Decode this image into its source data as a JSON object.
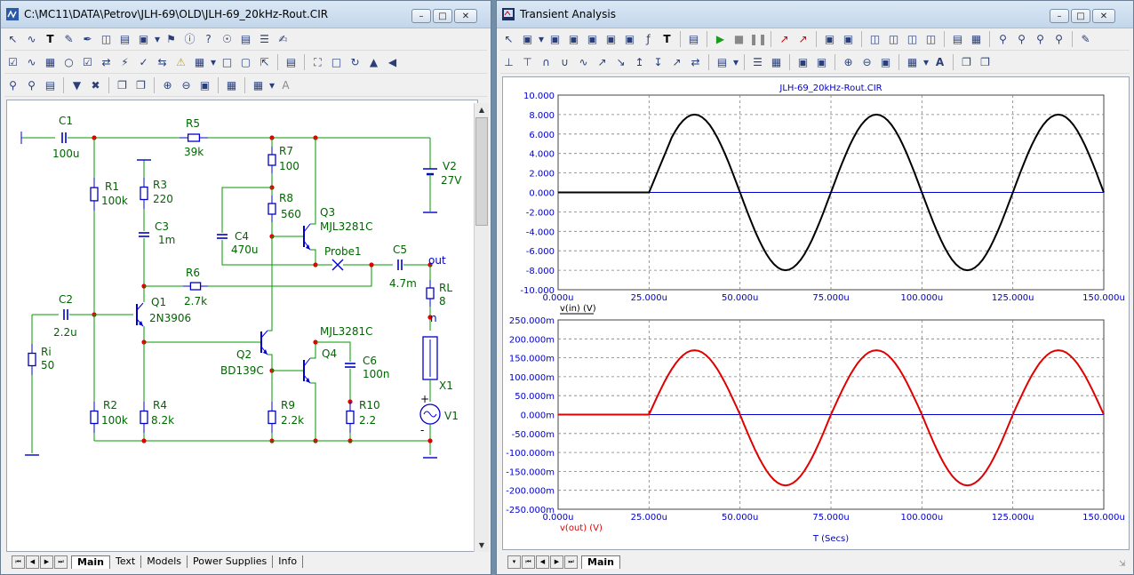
{
  "schematic_window": {
    "title": "C:\\MC11\\DATA\\Petrov\\JLH-69\\OLD\\JLH-69_20kHz-Rout.CIR",
    "tabs": [
      "Main",
      "Text",
      "Models",
      "Power Supplies",
      "Info"
    ],
    "active_tab": "Main"
  },
  "schematic": {
    "labels": {
      "c1": "C1",
      "c1v": "100u",
      "r5": "R5",
      "r5v": "39k",
      "r7": "R7",
      "r7v": "100",
      "v2": "V2",
      "v2v": "27V",
      "r1": "R1",
      "r1v": "100k",
      "r3": "R3",
      "r3v": "220",
      "c3": "C3",
      "c3v": "1m",
      "r8": "R8",
      "r8v": "560",
      "q3": "Q3",
      "q3v": "MJL3281C",
      "c4": "C4",
      "c4v": "470u",
      "probe": "Probe1",
      "c5": "C5",
      "c5v": "4.7m",
      "out": "out",
      "r6": "R6",
      "r6v": "2.7k",
      "rl": "RL",
      "rlv": "8",
      "n": "n",
      "c2": "C2",
      "c2v": "2.2u",
      "q1": "Q1",
      "q1v": "2N3906",
      "q4v": "MJL3281C",
      "ri": "Ri",
      "riv": "50",
      "q2": "Q2",
      "q2v": "BD139C",
      "q4": "Q4",
      "c6": "C6",
      "c6v": "100n",
      "x1": "X1",
      "r2": "R2",
      "r2v": "100k",
      "r4": "R4",
      "r4v": "8.2k",
      "r9": "R9",
      "r9v": "2.2k",
      "r10": "R10",
      "r10v": "2.2",
      "v1": "V1",
      "plus": "+",
      "minus": "-"
    }
  },
  "analysis_window": {
    "title": "Transient Analysis",
    "tabs": [
      "Main"
    ],
    "active_tab": "Main"
  },
  "colors": {
    "wire": "#009900",
    "component": "#0000cc",
    "label": "#006600",
    "vin_trace": "#000000",
    "vout_trace": "#e00000",
    "axis_text": "#0000cc",
    "grid": "#7f7f7f"
  },
  "chart_data": [
    {
      "type": "line",
      "title": "JLH-69_20kHz-Rout.CIR",
      "xlabel": "",
      "ylabel": "",
      "trace_label": "v(in) (V)",
      "xlim": [
        0,
        150
      ],
      "ylim": [
        -10,
        10
      ],
      "x_ticks": [
        "0.000u",
        "25.000u",
        "50.000u",
        "75.000u",
        "100.000u",
        "125.000u",
        "150.000u"
      ],
      "y_ticks": [
        "10.000",
        "8.000",
        "6.000",
        "4.000",
        "2.000",
        "0.000",
        "-2.000",
        "-4.000",
        "-6.000",
        "-8.000",
        "-10.000"
      ],
      "grid": true,
      "series": [
        {
          "name": "v(in) (V)",
          "color": "#000000",
          "line_width": 2,
          "x": [
            0,
            25,
            31.25,
            37.5,
            43.75,
            50,
            56.25,
            62.5,
            68.75,
            75,
            81.25,
            87.5,
            93.75,
            100,
            106.25,
            112.5,
            118.75,
            125,
            131.25,
            137.5,
            143.75,
            150
          ],
          "values": [
            0,
            0,
            5.66,
            8,
            5.66,
            0,
            -5.66,
            -8,
            -5.66,
            0,
            5.66,
            8,
            5.66,
            0,
            -5.66,
            -8,
            -5.66,
            0,
            5.66,
            8,
            5.66,
            0
          ]
        }
      ]
    },
    {
      "type": "line",
      "title": "",
      "xlabel": "T (Secs)",
      "ylabel": "",
      "trace_label": "v(out) (V)",
      "xlim": [
        0,
        150
      ],
      "ylim": [
        -250,
        250
      ],
      "y_unit": "m",
      "x_ticks": [
        "0.000u",
        "25.000u",
        "50.000u",
        "75.000u",
        "100.000u",
        "125.000u",
        "150.000u"
      ],
      "y_ticks": [
        "250.000m",
        "200.000m",
        "150.000m",
        "100.000m",
        "50.000m",
        "0.000m",
        "-50.000m",
        "-100.000m",
        "-150.000m",
        "-200.000m",
        "-250.000m"
      ],
      "grid": true,
      "series": [
        {
          "name": "v(out) (V)",
          "color": "#e00000",
          "line_width": 2,
          "x": [
            0,
            25,
            25.1,
            31.25,
            37.5,
            43.75,
            50,
            56.25,
            62.5,
            68.75,
            75,
            81.25,
            87.5,
            93.75,
            100,
            106.25,
            112.5,
            118.75,
            125,
            131.25,
            137.5,
            143.75,
            150
          ],
          "values": [
            0,
            0,
            12,
            125,
            170,
            125,
            0,
            -130,
            -187,
            -130,
            0,
            125,
            170,
            125,
            0,
            -130,
            -187,
            -130,
            0,
            125,
            170,
            125,
            0
          ]
        }
      ]
    }
  ]
}
